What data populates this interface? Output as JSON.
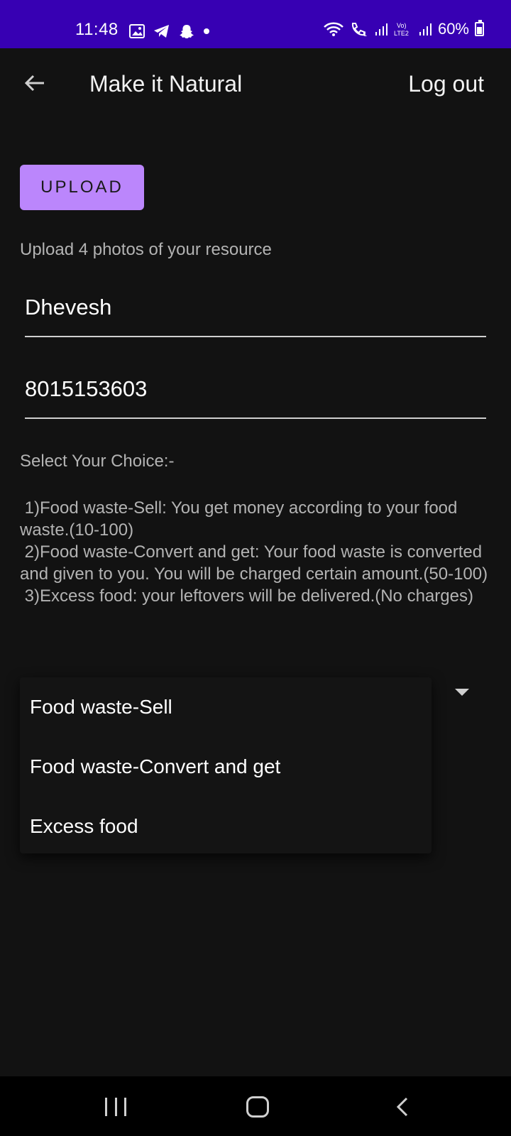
{
  "status_bar": {
    "time": "11:48",
    "battery": "60%",
    "icons": [
      "gallery-icon",
      "telegram-icon",
      "snapchat-icon",
      "dot-icon",
      "wifi-icon",
      "call-icon",
      "signal-icon",
      "volte-icon",
      "signal-icon",
      "battery-icon"
    ],
    "color": "#3700b3"
  },
  "app_bar": {
    "title": "Make it Natural",
    "logout_label": "Log out"
  },
  "upload": {
    "button_label": "UPLOAD",
    "hint": "Upload 4 photos of your resource",
    "accent": "#bb86fc"
  },
  "form": {
    "name_value": "Dhevesh",
    "phone_value": "8015153603"
  },
  "choices": {
    "header": "Select Your Choice:-",
    "lines": [
      " 1)Food waste-Sell: You get money according to your food waste.(10-100)",
      " 2)Food waste-Convert and get: Your food waste is converted and given to you. You will be charged certain amount.(50-100)",
      " 3)Excess food: your leftovers will be delivered.(No charges)"
    ]
  },
  "dropdown": {
    "options": [
      "Food waste-Sell",
      "Food waste-Convert and get",
      "Excess food"
    ]
  }
}
